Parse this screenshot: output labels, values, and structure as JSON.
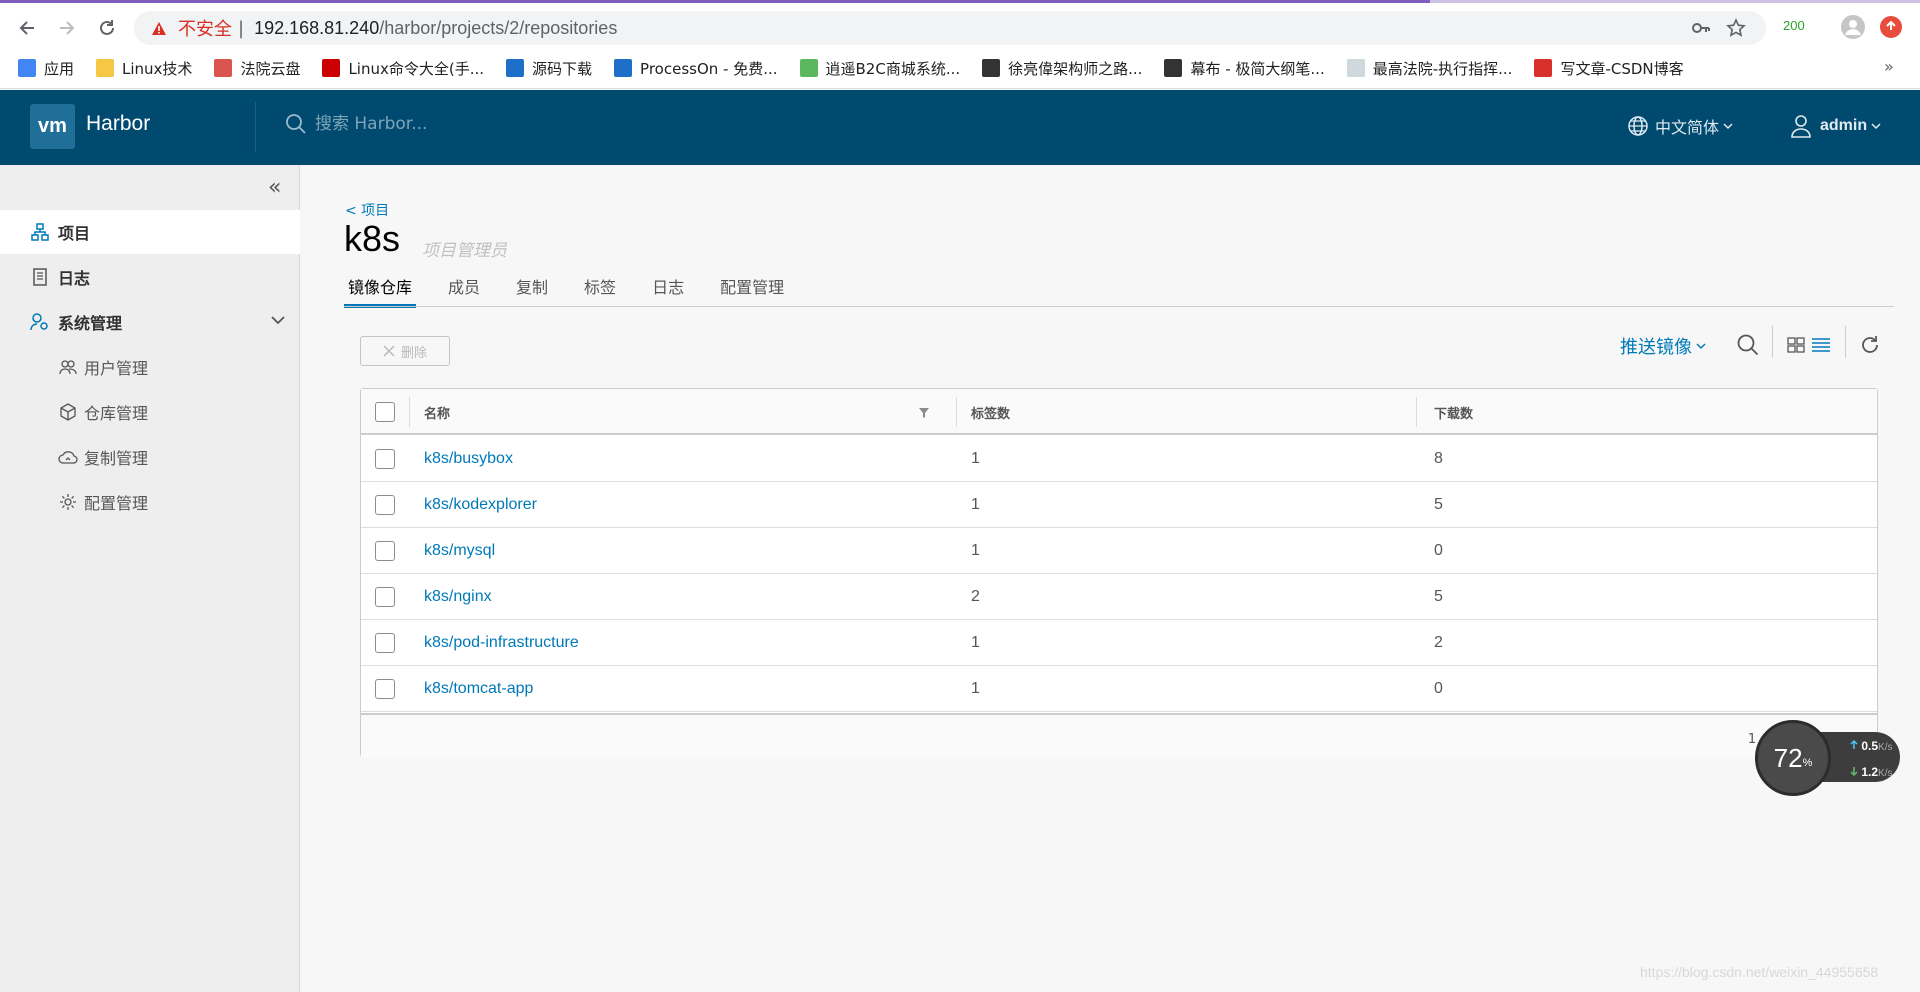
{
  "browser": {
    "security_text": "不安全",
    "separator": "|",
    "url_host": "192.168.81.240",
    "url_path": "/harbor/projects/2/repositories",
    "ext_badge": "200",
    "bookmarks": [
      {
        "label": "应用",
        "icon": "apps-grid-icon",
        "color": "#4285f4"
      },
      {
        "label": "Linux技术",
        "icon": "folder-icon",
        "color": "#f6c744"
      },
      {
        "label": "法院云盘",
        "icon": "cloud-disk-icon",
        "color": "#d9534f"
      },
      {
        "label": "Linux命令大全(手...",
        "icon": "redhat-icon",
        "color": "#cc0000"
      },
      {
        "label": "源码下载",
        "icon": "source-code-icon",
        "color": "#1e6fc7"
      },
      {
        "label": "ProcessOn - 免费...",
        "icon": "processon-icon",
        "color": "#1e6fc7"
      },
      {
        "label": "逍遥B2C商城系统...",
        "icon": "m-logo-icon",
        "color": "#5cb85c"
      },
      {
        "label": "徐亮偉架构师之路...",
        "icon": "blog-icon",
        "color": "#333333"
      },
      {
        "label": "幕布 - 极简大纲笔...",
        "icon": "mubu-icon",
        "color": "#333333"
      },
      {
        "label": "最高法院-执行指挥...",
        "icon": "page-icon",
        "color": "#cfd8dc"
      },
      {
        "label": "写文章-CSDN博客",
        "icon": "csdn-icon",
        "color": "#d9302c"
      }
    ]
  },
  "header": {
    "logo_text": "vm",
    "app_name": "Harbor",
    "search_placeholder": "搜索 Harbor...",
    "language": "中文简体",
    "user": "admin",
    "bg_color": "#004a70"
  },
  "sidebar": {
    "items": [
      {
        "label": "项目",
        "icon": "projects-icon",
        "active": true
      },
      {
        "label": "日志",
        "icon": "log-icon",
        "active": false
      },
      {
        "label": "系统管理",
        "icon": "admin-icon",
        "active": false
      }
    ],
    "sub_items": [
      {
        "label": "用户管理",
        "icon": "users-icon"
      },
      {
        "label": "仓库管理",
        "icon": "registry-icon"
      },
      {
        "label": "复制管理",
        "icon": "replication-icon"
      },
      {
        "label": "配置管理",
        "icon": "settings-icon"
      }
    ]
  },
  "main": {
    "back_link": "< 项目",
    "project_name": "k8s",
    "role": "项目管理员",
    "tabs": [
      "镜像仓库",
      "成员",
      "复制",
      "标签",
      "日志",
      "配置管理"
    ],
    "active_tab": 0,
    "delete_label": "删除",
    "push_label": "推送镜像",
    "columns": [
      "名称",
      "标签数",
      "下载数"
    ],
    "rows": [
      {
        "name": "k8s/busybox",
        "tags": "1",
        "pulls": "8"
      },
      {
        "name": "k8s/kodexplorer",
        "tags": "1",
        "pulls": "5"
      },
      {
        "name": "k8s/mysql",
        "tags": "1",
        "pulls": "0"
      },
      {
        "name": "k8s/nginx",
        "tags": "2",
        "pulls": "5"
      },
      {
        "name": "k8s/pod-infrastructure",
        "tags": "1",
        "pulls": "2"
      },
      {
        "name": "k8s/tomcat-app",
        "tags": "1",
        "pulls": "0"
      }
    ],
    "footer": "1 - 6 共计 6 条记录",
    "accent_color": "#0079b8"
  },
  "widget": {
    "percent": "72",
    "percent_unit": "%",
    "up": "0.5",
    "down": "1.2",
    "unit": "K/s"
  },
  "watermark": "https://blog.csdn.net/weixin_44955658"
}
